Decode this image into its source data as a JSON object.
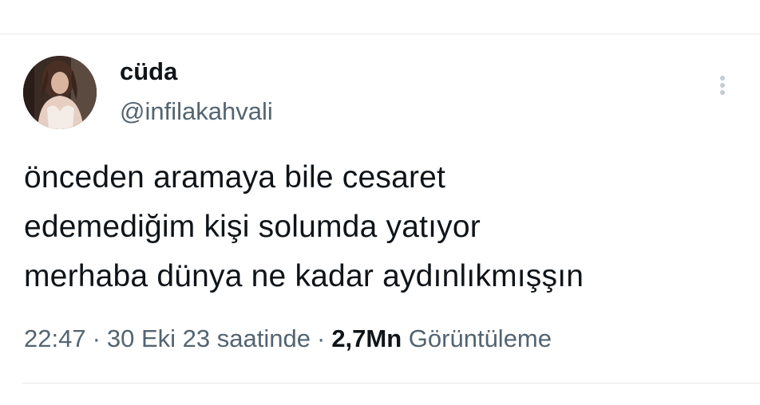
{
  "tweet": {
    "author": {
      "display_name": "cüda",
      "handle": "@infilakahvali"
    },
    "text_lines": [
      "önceden aramaya bile cesaret",
      "edemediğim kişi solumda yatıyor",
      "merhaba dünya ne kadar aydınlıkmışşın"
    ],
    "meta": {
      "time": "22:47",
      "separator": "·",
      "date": "30 Eki 23 saatinde",
      "views_count": "2,7Mn",
      "views_label": "Görüntüleme"
    },
    "icons": {
      "more": "more-vertical-icon"
    }
  },
  "colors": {
    "text_primary": "#0f1419",
    "text_secondary": "#536471",
    "divider": "#e7e9ea",
    "more_icon": "#c4cbd0"
  }
}
